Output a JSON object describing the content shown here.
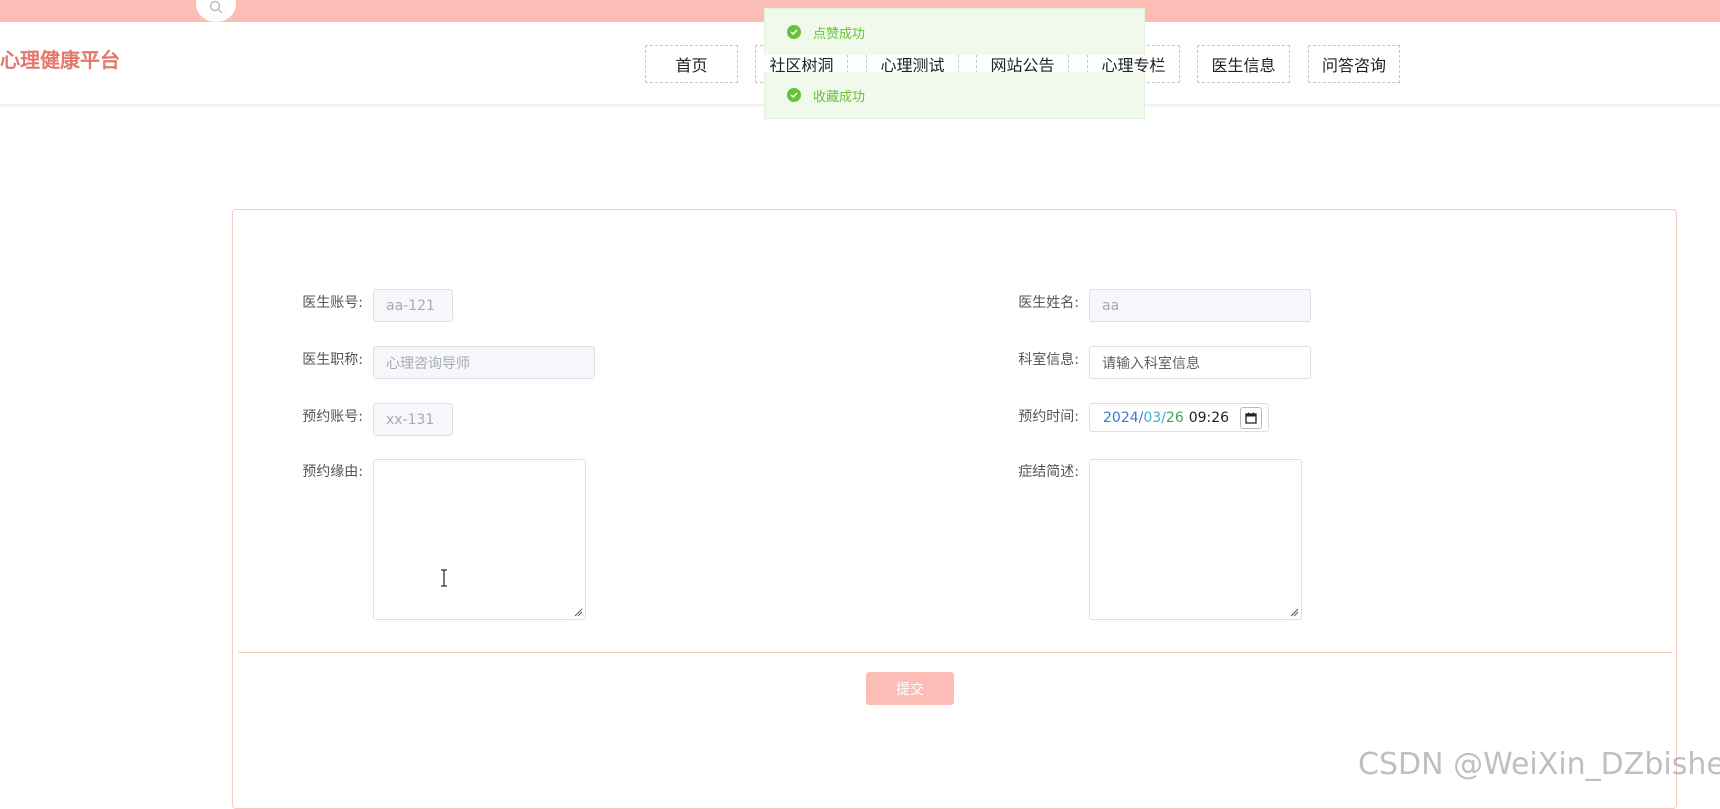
{
  "app": {
    "title": "心理健康平台"
  },
  "nav": {
    "items": [
      {
        "label": "首页"
      },
      {
        "label": "社区树洞"
      },
      {
        "label": "心理测试"
      },
      {
        "label": "网站公告"
      },
      {
        "label": "心理专栏"
      },
      {
        "label": "医生信息"
      },
      {
        "label": "问答咨询"
      }
    ]
  },
  "toasts": [
    {
      "text": "点赞成功",
      "type": "success"
    },
    {
      "text": "收藏成功",
      "type": "success"
    }
  ],
  "form": {
    "doctor_account": {
      "label": "医生账号:",
      "value": "aa-121"
    },
    "doctor_name": {
      "label": "医生姓名:",
      "value": "aa"
    },
    "doctor_title": {
      "label": "医生职称:",
      "value": "心理咨询导师"
    },
    "department": {
      "label": "科室信息:",
      "placeholder": "请输入科室信息"
    },
    "booking_account": {
      "label": "预约账号:",
      "value": "xx-131"
    },
    "booking_time": {
      "label": "预约时间:",
      "year": "2024",
      "month": "03",
      "day": "26",
      "time": "09:26"
    },
    "booking_reason": {
      "label": "预约缘由:",
      "value": ""
    },
    "symptoms": {
      "label": "症结简述:",
      "value": ""
    },
    "submit_label": "提交"
  },
  "watermark": "CSDN @WeiXin_DZbishe",
  "colors": {
    "accent": "#fdbdb7",
    "logo": "#e07a6e",
    "success": "#67c23a"
  }
}
